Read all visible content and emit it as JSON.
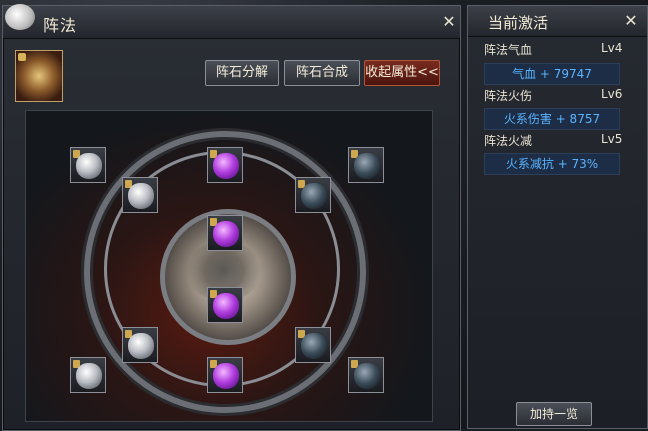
{
  "main": {
    "title": "阵法",
    "close_glyph": "✕",
    "buttons": {
      "decompose": "阵石分解",
      "synthesize": "阵石合成",
      "collapse": "收起属性<<"
    }
  },
  "side": {
    "title": "当前激活",
    "close_glyph": "✕",
    "stats": [
      {
        "name": "阵法气血",
        "level": "Lv4",
        "value": "气血 + 79747"
      },
      {
        "name": "阵法火伤",
        "level": "Lv6",
        "value": "火系伤害 + 8757"
      },
      {
        "name": "阵法火减",
        "level": "Lv5",
        "value": "火系减抗 + 73%"
      }
    ],
    "bonus_button": "加持一览"
  },
  "colors": {
    "accent_blue": "#5ab4ff",
    "button_red": "#7a2a1e",
    "gem_purple": "#b23ee0"
  },
  "icons": [
    "close-icon",
    "lock-icon",
    "array-portrait-icon",
    "gem-icon"
  ]
}
